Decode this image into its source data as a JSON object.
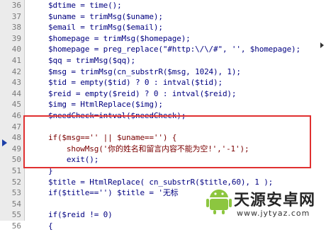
{
  "editor": {
    "lines": [
      {
        "n": "36",
        "text": "$dtime = time();"
      },
      {
        "n": "37",
        "text": "$uname = trimMsg($uname);"
      },
      {
        "n": "38",
        "text": "$email = trimMsg($email);"
      },
      {
        "n": "39",
        "text": "$homepage = trimMsg($homepage);"
      },
      {
        "n": "40",
        "text": "$homepage = preg_replace(\"#http:\\/\\/#\", '', $homepage);"
      },
      {
        "n": "41",
        "text": "$qq = trimMsg($qq);"
      },
      {
        "n": "42",
        "text": "$msg = trimMsg(cn_substrR($msg, 1024), 1);"
      },
      {
        "n": "43",
        "text": "$tid = empty($tid) ? 0 : intval($tid);"
      },
      {
        "n": "44",
        "text": "$reid = empty($reid) ? 0 : intval($reid);"
      },
      {
        "n": "45",
        "text": "$img = HtmlReplace($img);"
      },
      {
        "n": "46",
        "text": "$needCheck=intval($needCheck);"
      },
      {
        "n": "47",
        "text": ""
      },
      {
        "n": "48",
        "text": "if($msg=='' || $uname=='') {"
      },
      {
        "n": "49",
        "text": "    showMsg('你的姓名和留言内容不能为空!','-1');"
      },
      {
        "n": "50",
        "text": "    exit();"
      },
      {
        "n": "51",
        "text": "}"
      },
      {
        "n": "52",
        "text": "$title = HtmlReplace( cn_substrR($title,60), 1 );"
      },
      {
        "n": "53",
        "text": "if($title=='') $title = '无标"
      },
      {
        "n": "54",
        "text": ""
      },
      {
        "n": "55",
        "text": "if($reid != 0)"
      },
      {
        "n": "56",
        "text": "{"
      }
    ]
  },
  "watermark": {
    "title": "天源安卓网",
    "url": "www.jytyaz.com"
  },
  "colors": {
    "gutter": "#ebebeb",
    "code": "#000080",
    "highlight": "#e03030",
    "bookmark": "#1c3fa8"
  }
}
